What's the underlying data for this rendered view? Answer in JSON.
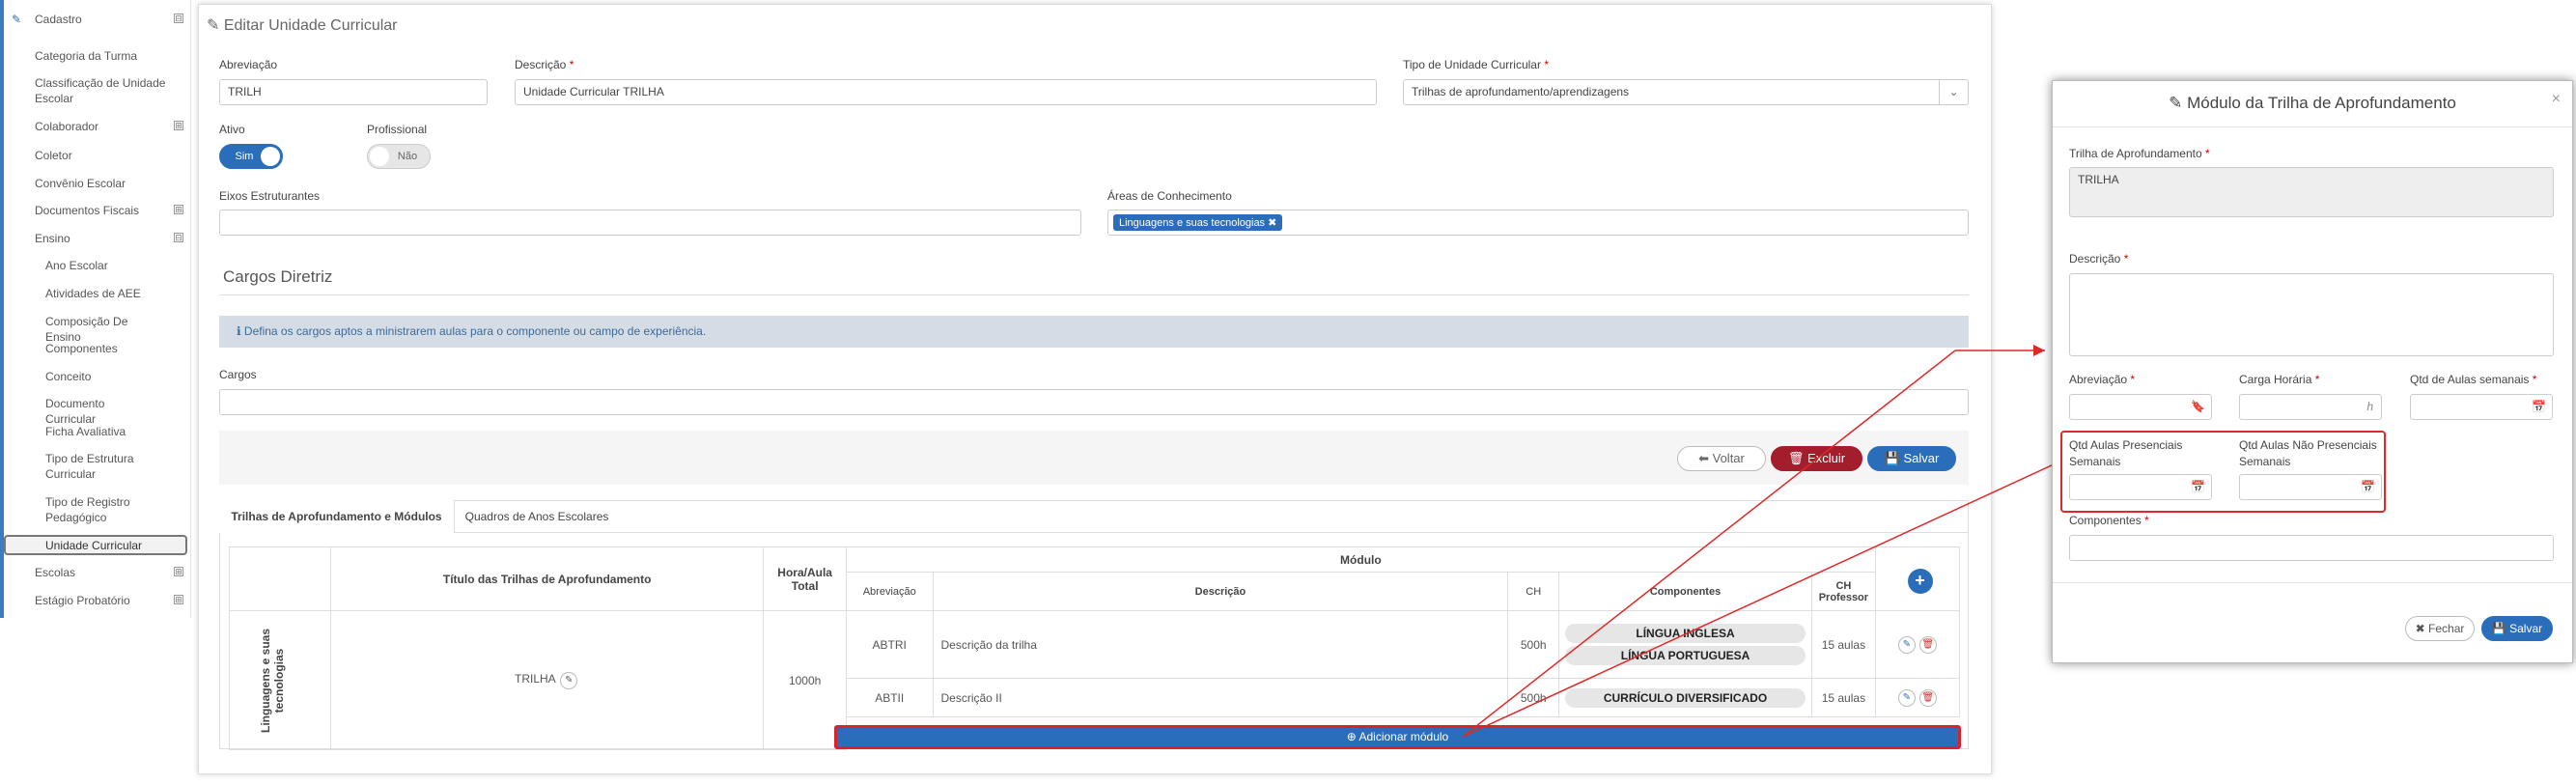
{
  "sidebar": {
    "items": [
      {
        "label": "Cadastro",
        "toggle": "⊟"
      },
      {
        "label": "Categoria da Turma"
      },
      {
        "label": "Classificação de Unidade Escolar"
      },
      {
        "label": "Colaborador",
        "toggle": "⊞"
      },
      {
        "label": "Coletor"
      },
      {
        "label": "Convênio Escolar"
      },
      {
        "label": "Documentos Fiscais",
        "toggle": "⊞"
      },
      {
        "label": "Ensino",
        "toggle": "⊟"
      },
      {
        "label": "Ano Escolar"
      },
      {
        "label": "Atividades de AEE"
      },
      {
        "label": "Composição De Ensino"
      },
      {
        "label": "Componentes"
      },
      {
        "label": "Conceito"
      },
      {
        "label": "Documento Curricular"
      },
      {
        "label": "Ficha Avaliativa"
      },
      {
        "label": "Tipo de Estrutura Curricular"
      },
      {
        "label": "Tipo de Registro Pedagógico"
      },
      {
        "label": "Unidade Curricular"
      },
      {
        "label": "Escolas",
        "toggle": "⊞"
      },
      {
        "label": "Estágio Probatório",
        "toggle": "⊞"
      }
    ]
  },
  "form": {
    "title": "Editar Unidade Curricular",
    "abbr_label": "Abreviação",
    "abbr_value": "TRILH",
    "desc_label": "Descrição",
    "desc_value": "Unidade Curricular TRILHA",
    "type_label": "Tipo de Unidade Curricular",
    "type_value": "Trilhas de aprofundamento/aprendizagens",
    "ativo_label": "Ativo",
    "ativo_value": "Sim",
    "prof_label": "Profissional",
    "prof_value": "Não",
    "eixos_label": "Eixos Estruturantes",
    "areas_label": "Áreas de Conhecimento",
    "areas_tag": "Linguagens e suas tecnologias",
    "section_title": "Cargos Diretriz",
    "info_text": "Defina os cargos aptos a ministrarem aulas para o componente ou campo de experiência.",
    "cargos_label": "Cargos",
    "btn_voltar": "Voltar",
    "btn_excluir": "Excluir",
    "btn_salvar": "Salvar",
    "tab1": "Trilhas de Aprofundamento e Módulos",
    "tab2": "Quadros de Anos Escolares"
  },
  "table": {
    "headers": {
      "titulo": "Título das Trilhas de Aprofundamento",
      "hora": "Hora/Aula Total",
      "modulo": "Módulo",
      "abrev": "Abreviação",
      "desc": "Descrição",
      "ch": "CH",
      "comp": "Componentes",
      "chprof": "CH Professor"
    },
    "group": "Linguagens e suas tecnologias",
    "trilha": "TRILHA",
    "hora_total": "1000h",
    "rows": [
      {
        "abrev": "ABTRI",
        "desc": "Descrição da trilha",
        "ch": "500h",
        "comps": [
          "LÍNGUA INGLESA",
          "LÍNGUA PORTUGUESA"
        ],
        "chprof": "15 aulas"
      },
      {
        "abrev": "ABTII",
        "desc": "Descrição II",
        "ch": "500h",
        "comps": [
          "CURRÍCULO DIVERSIFICADO"
        ],
        "chprof": "15 aulas"
      }
    ],
    "add_module": "Adicionar módulo"
  },
  "modal": {
    "title": "Módulo da Trilha de Aprofundamento",
    "trilha_label": "Trilha de Aprofundamento",
    "trilha_value": "TRILHA",
    "desc_label": "Descrição",
    "abbr_label": "Abreviação",
    "ch_label": "Carga Horária",
    "ch_unit": "h",
    "qtd_label": "Qtd de Aulas semanais",
    "pres_label": "Qtd Aulas Presenciais Semanais",
    "npres_label": "Qtd Aulas Não Presenciais Semanais",
    "comp_label": "Componentes",
    "btn_fechar": "Fechar",
    "btn_salvar": "Salvar"
  },
  "colors": {
    "primary": "#2a6ebb",
    "danger": "#a31d2c",
    "highlight": "#e02828"
  }
}
